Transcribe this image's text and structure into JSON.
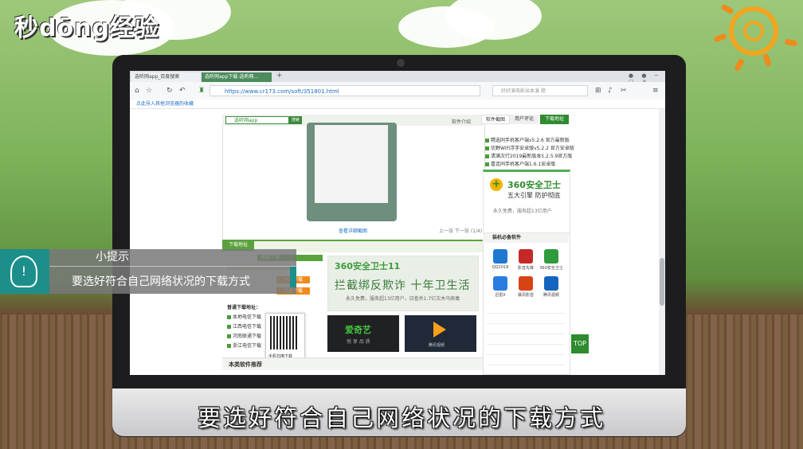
{
  "brand": {
    "logo_text": "秒dōng经验"
  },
  "browser": {
    "tabs": [
      {
        "label": "选听网app_百度搜索"
      },
      {
        "label": "选听网app下载-选听网..."
      }
    ],
    "new_tab": "+",
    "url": "https://www.cr173.com/soft/351801.html",
    "search_placeholder": "好好演电影出本演 题",
    "bookmark_bar": "点此导入其他浏览器的收藏"
  },
  "page": {
    "site_search_value": "选听网app",
    "site_search_button": "搜索",
    "software_intro_tab": "软件介绍",
    "screenshot_caption": "查看详细截图",
    "pager": "上一张 下一张 (1/4)",
    "download_tab": "下载地址",
    "ad": {
      "logo": "360安全卫士11",
      "slogan": "拦截绑反欺诈 十年卫生活",
      "sub": "永久免费，服务超13亿用户，日查杀1.7亿次木马病毒"
    },
    "safe_dl_label": "高速下载",
    "safe_dl_buttons": [
      "高速下载",
      "高速下载",
      "高速下载"
    ],
    "normal_dl_title": "普通下载地址：",
    "normal_dl_items": [
      "本地电信下载",
      "江西电信下载",
      "河南联通下载",
      "浙江电信下载"
    ],
    "qr_label": "手机扫描下载",
    "related_title": "本类软件推荐",
    "iqiyi_label": "爱奇艺",
    "iqiyi_sub": "悦 享 品 质",
    "tencent_label": "腾讯视频"
  },
  "sidebar": {
    "tabs": [
      "软件截图",
      "用户评论",
      "下载地址"
    ],
    "news": [
      "精选同手机客户端v5.2.6 官方最新版",
      "优野WiFi浮手安卓版v5.2.2 官方安卓版",
      "清满次行2019最新版本5.2.5.9官方版",
      "喜连同手机客户端1.6.1安卓版"
    ],
    "ad360": {
      "title": "360安全卫士",
      "line": "五大引擎 防护彻底",
      "sub": "永久免费，服务超13亿用户"
    },
    "must_title": "装机必备软件",
    "apps": [
      {
        "name": "QQ2018",
        "color": "#1f78d1"
      },
      {
        "name": "影音先锋",
        "color": "#c62828"
      },
      {
        "name": "360安全卫士",
        "color": "#2e9b3c"
      },
      {
        "name": "迅雷X",
        "color": "#2a7be0"
      },
      {
        "name": "暴风影音",
        "color": "#d84315"
      },
      {
        "name": "腾讯视频",
        "color": "#1565c0"
      }
    ],
    "top_button": "TOP"
  },
  "overlay": {
    "tip_title": "小提示",
    "tip_text": "要选好符合自己网络状况的下载方式",
    "subtitle": "要选好符合自己网络状况的下载方式"
  }
}
